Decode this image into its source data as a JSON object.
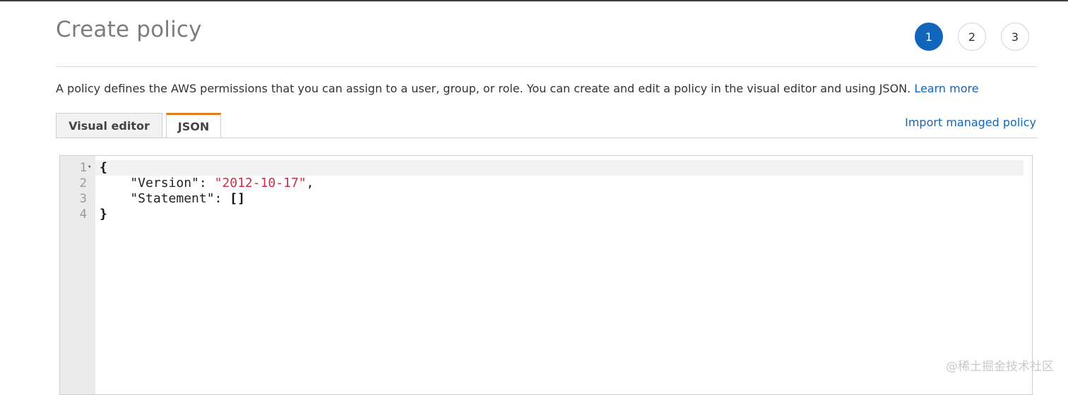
{
  "page": {
    "title": "Create policy",
    "description": "A policy defines the AWS permissions that you can assign to a user, group, or role. You can create and edit a policy in the visual editor and using JSON. ",
    "learn_more": "Learn more"
  },
  "steps": [
    {
      "label": "1",
      "active": true
    },
    {
      "label": "2",
      "active": false
    },
    {
      "label": "3",
      "active": false
    }
  ],
  "tabs": {
    "visual_editor": "Visual editor",
    "json": "JSON",
    "selected": "JSON"
  },
  "import_link": "Import managed policy",
  "editor": {
    "line_numbers": [
      "1",
      "2",
      "3",
      "4"
    ],
    "lines": {
      "l1_open": "{",
      "l2_key": "    \"Version\": ",
      "l2_value": "\"2012-10-17\"",
      "l2_tail": ",",
      "l3_key": "    \"Statement\": ",
      "l3_value": "[]",
      "l4_close": "}"
    }
  },
  "watermark": "@稀土掘金技术社区",
  "colors": {
    "accent": "#1166bb",
    "active_tab_border": "#e07b1f",
    "json_string": "#d02d4b"
  },
  "icons": {
    "fold_marker": "fold-caret-icon"
  }
}
